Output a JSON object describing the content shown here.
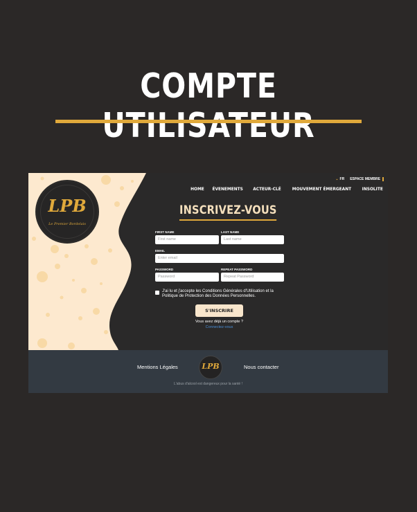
{
  "hero": {
    "title": "COMPTE UTILISATEUR"
  },
  "colors": {
    "accent": "#e0a93b",
    "cream": "#fde9cf",
    "dark": "#2a2929",
    "footer": "#333a42",
    "link": "#4a8fd8"
  },
  "logo": {
    "mark": "LPB",
    "subtitle": "Le Premier Bordelais"
  },
  "topbar": {
    "lang_icon": "chevron-down-icon",
    "lang": "FR",
    "espace": "ESPACE MEMBRE"
  },
  "nav": {
    "items": [
      "HOME",
      "ÉVENEMENTS",
      "ACTEUR-CLÉ",
      "MOUVEMENT ÉMERGEANT",
      "INSOLITE"
    ]
  },
  "form": {
    "title": "INSCRIVEZ-VOUS",
    "first_name": {
      "label": "FIRST NAME",
      "placeholder": "First name"
    },
    "last_name": {
      "label": "LAST NAME",
      "placeholder": "Last name"
    },
    "email": {
      "label": "EMAIL",
      "placeholder": "Enter email"
    },
    "password": {
      "label": "PASSWORD",
      "placeholder": "Password"
    },
    "repeat_password": {
      "label": "REPEAT PASSWORD",
      "placeholder": "Repeat Password"
    },
    "terms": "J'ai lu et j'accepte les Conditions Générales d'Utilisation et la Politique de Protection des Données Personnelles.",
    "submit": "S'INSCRIRE",
    "have_account": "Vous avez déjà un compte ?",
    "login_link": "Connectez-vous"
  },
  "footer": {
    "legal": "Mentions Légales",
    "contact": "Nous contacter",
    "logo_mark": "LPB",
    "note": "L'abus d'alcool est dangereux pour la santé !"
  }
}
